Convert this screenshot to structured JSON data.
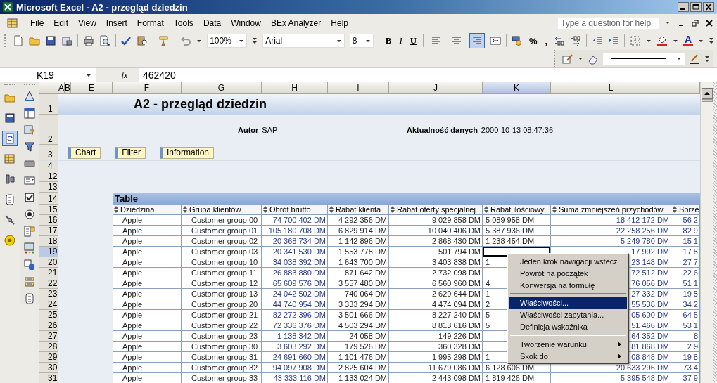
{
  "window": {
    "title": "Microsoft Excel - A2 - przegląd dziedzin"
  },
  "menu_bar": {
    "items": [
      "File",
      "Edit",
      "View",
      "Insert",
      "Format",
      "Tools",
      "Data",
      "Window",
      "BEx Analyzer",
      "Help"
    ],
    "help_box": {
      "placeholder": "Type a question for help"
    }
  },
  "standard_toolbar": {
    "zoom": "100%",
    "font": "Arial",
    "font_size": "8",
    "format_buttons": [
      "B",
      "I",
      "U"
    ],
    "alignment_buttons": [
      {
        "selected": false
      },
      {
        "selected": false
      },
      {
        "selected": true
      }
    ],
    "number_buttons": [
      "%",
      ","
    ],
    "font_color_label": "A"
  },
  "bex_toolbar": [
    {
      "pressed": false
    },
    {
      "pressed": false
    },
    {
      "pressed": true
    },
    {
      "pressed": false
    },
    {
      "pressed": false
    },
    {
      "pressed": false
    },
    {
      "pressed": false
    },
    {
      "pressed": false
    }
  ],
  "formula_bar": {
    "name_box": "K19",
    "function_label": "fx",
    "value": "462420"
  },
  "sheet": {
    "column_headers": [
      {
        "label": "A",
        "selected": false
      },
      {
        "label": "B",
        "selected": false
      },
      {
        "label": "E",
        "selected": false
      },
      {
        "label": "F",
        "selected": false
      },
      {
        "label": "G",
        "selected": false
      },
      {
        "label": "H",
        "selected": false
      },
      {
        "label": "I",
        "selected": false
      },
      {
        "label": "J",
        "selected": false
      },
      {
        "label": "K",
        "selected": true
      },
      {
        "label": "L",
        "selected": false
      }
    ],
    "row_numbers": [
      "1",
      "2",
      "3",
      "4",
      "12",
      "13",
      "14",
      "15"
    ],
    "title": "A2 - przegląd dziedzin",
    "author_label": "Autor",
    "author": "SAP",
    "data_date_label": "Aktualność danych",
    "data_date": "2000-10-13 08:47:36",
    "buttons": [
      "Chart",
      "Filter",
      "Information"
    ]
  },
  "table": {
    "title": "Table",
    "columns": [
      "Dziedzina",
      "Grupa klientów",
      "Obrót brutto",
      "Rabat klienta",
      "Rabat oferty specjalnej",
      "Rabat ilościowy",
      "Suma zmniejszeń przychodów",
      "Sprze"
    ],
    "rows": [
      {
        "row": "16",
        "selected": false,
        "cells": [
          "Apple",
          "Customer group 00",
          "74 700 402 DM",
          "4 292 356 DM",
          "9 029 858 DM",
          "5 089 958 DM",
          "18 412 172 DM",
          "56 2"
        ]
      },
      {
        "row": "17",
        "selected": false,
        "cells": [
          "Apple",
          "Customer group 01",
          "105 180 708 DM",
          "6 829 914 DM",
          "10 040 406 DM",
          "5 387 936 DM",
          "22 258 256 DM",
          "82 9"
        ]
      },
      {
        "row": "18",
        "selected": false,
        "cells": [
          "Apple",
          "Customer group 02",
          "20 368 734 DM",
          "1 142 896 DM",
          "2 868 430 DM",
          "1 238 454 DM",
          "5 249 780 DM",
          "15 1"
        ]
      },
      {
        "row": "19",
        "selected": true,
        "cells": [
          "Apple",
          "Customer group 03",
          "20 341 530 DM",
          "1 553 778 DM",
          "501 794 DM",
          null,
          "17 992 DM",
          "17 8"
        ]
      },
      {
        "row": "20",
        "selected": false,
        "cells": [
          "Apple",
          "Customer group 10",
          "34 038 392 DM",
          "1 643 700 DM",
          "3 403 838 DM",
          "1",
          "23 148 DM",
          "27 7"
        ]
      },
      {
        "row": "21",
        "selected": false,
        "cells": [
          "Apple",
          "Customer group 11",
          "26 883 880 DM",
          "871 642 DM",
          "2 732 098 DM",
          null,
          "72 512 DM",
          "22 6"
        ]
      },
      {
        "row": "22",
        "selected": false,
        "cells": [
          "Apple",
          "Customer group 12",
          "65 609 576 DM",
          "3 557 480 DM",
          "6 560 960 DM",
          "4",
          "76 056 DM",
          "51 1"
        ]
      },
      {
        "row": "23",
        "selected": false,
        "cells": [
          "Apple",
          "Customer group 13",
          "24 042 502 DM",
          "740 064 DM",
          "2 629 644 DM",
          "1",
          "27 332 DM",
          "19 5"
        ]
      },
      {
        "row": "24",
        "selected": false,
        "cells": [
          "Apple",
          "Customer group 20",
          "44 740 954 DM",
          "3 333 294 DM",
          "4 474 094 DM",
          "2",
          "55 538 DM",
          "34 2"
        ]
      },
      {
        "row": "25",
        "selected": false,
        "cells": [
          "Apple",
          "Customer group 21",
          "82 272 396 DM",
          "3 501 666 DM",
          "8 227 240 DM",
          "5",
          "05 600 DM",
          "64 5"
        ]
      },
      {
        "row": "26",
        "selected": false,
        "cells": [
          "Apple",
          "Customer group 22",
          "72 336 376 DM",
          "4 503 294 DM",
          "8 813 616 DM",
          "5",
          "51 466 DM",
          "53 1"
        ]
      },
      {
        "row": "27",
        "selected": false,
        "cells": [
          "Apple",
          "Customer group 23",
          "1 138 342 DM",
          "24 058 DM",
          "149 226 DM",
          null,
          "64 352 DM",
          "8"
        ]
      },
      {
        "row": "28",
        "selected": false,
        "cells": [
          "Apple",
          "Customer group 30",
          "3 603 292 DM",
          "179 526 DM",
          "360 328 DM",
          null,
          "81 868 DM",
          "2 9"
        ]
      },
      {
        "row": "29",
        "selected": false,
        "cells": [
          "Apple",
          "Customer group 31",
          "24 691 660 DM",
          "1 101 476 DM",
          "1 995 298 DM",
          "1",
          "08 848 DM",
          "19 8"
        ]
      },
      {
        "row": "30",
        "selected": false,
        "cells": [
          "Apple",
          "Customer group 32",
          "94 097 908 DM",
          "2 825 604 DM",
          "11 679 086 DM",
          "6 128 606 DM",
          "20 633 296 DM",
          "73 4"
        ]
      },
      {
        "row": "31",
        "selected": false,
        "cells": [
          "Apple",
          "Customer group 33",
          "43 333 116 DM",
          "1 133 024 DM",
          "2 443 098 DM",
          "1 819 426 DM",
          "5 395 548 DM",
          "37 9"
        ]
      }
    ]
  },
  "context_menu": {
    "items": [
      {
        "kind": "item",
        "label": "Jeden krok nawigacji wstecz",
        "selected": false,
        "submenu": false
      },
      {
        "kind": "item",
        "label": "Powrót na początek",
        "selected": false,
        "submenu": false
      },
      {
        "kind": "item",
        "label": "Konwersja na formułę",
        "selected": false,
        "submenu": false
      },
      {
        "kind": "separator"
      },
      {
        "kind": "item",
        "label": "Właściwości...",
        "selected": true,
        "submenu": false
      },
      {
        "kind": "item",
        "label": "Właściwości zapytania...",
        "selected": false,
        "submenu": false
      },
      {
        "kind": "item",
        "label": "Definicja wskaźnika",
        "selected": false,
        "submenu": false
      },
      {
        "kind": "separator"
      },
      {
        "kind": "item",
        "label": "Tworzenie warunku",
        "selected": false,
        "submenu": true
      },
      {
        "kind": "item",
        "label": "Skok do",
        "selected": false,
        "submenu": true
      }
    ]
  }
}
